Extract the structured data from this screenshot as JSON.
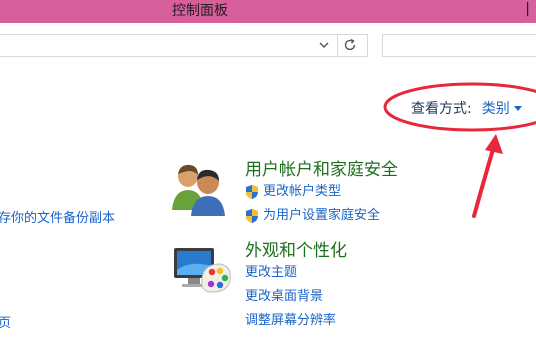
{
  "window": {
    "title": "控制面板"
  },
  "view": {
    "label": "查看方式:",
    "value": "类别"
  },
  "left_fragments": [
    "存你的文件备份副本",
    "页"
  ],
  "categories": [
    {
      "title": "用户帐户和家庭安全",
      "icon": "users-icon",
      "links": [
        "更改帐户类型",
        "为用户设置家庭安全"
      ]
    },
    {
      "title": "外观和个性化",
      "icon": "display-palette-icon",
      "links": [
        "更改主题",
        "更改桌面背景",
        "调整屏幕分辨率"
      ]
    }
  ],
  "colors": {
    "titlebar": "#d65f9c",
    "link": "#1a64c8",
    "category_title": "#1d6f1d",
    "annotation": "#e8283a"
  }
}
